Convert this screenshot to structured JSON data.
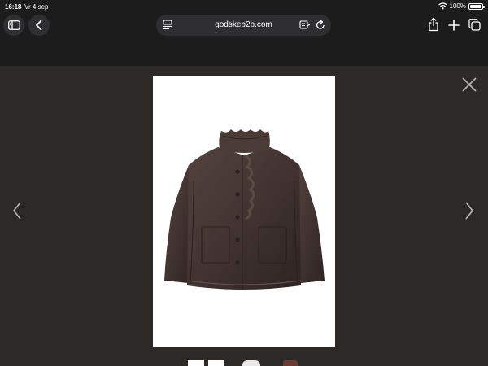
{
  "status_bar": {
    "time": "16:18",
    "date": "Vr 4 sep",
    "battery": "100%",
    "battery_level": 1.0
  },
  "browser": {
    "url": "godskeb2b.com",
    "icons": {
      "sidebar": "sidebar-icon",
      "back": "chevron-left-icon",
      "page_menu": "page-menu-icon",
      "reader": "reader-icon",
      "reload": "reload-icon",
      "share": "share-icon",
      "new_tab": "plus-icon",
      "tabs": "tabs-icon"
    }
  },
  "lightbox": {
    "product_image": "brown leather cropped jacket with ruffled stand collar",
    "icons": {
      "close": "close-icon",
      "previous": "chevron-left-icon",
      "next": "chevron-right-icon"
    },
    "thumbnails": [
      "thumbnail-1",
      "thumbnail-2",
      "thumbnail-3",
      "thumbnail-4"
    ]
  },
  "colors": {
    "chrome": "#1c1c1d",
    "overlay": "#2c2926",
    "jacket": "#3f3230"
  }
}
